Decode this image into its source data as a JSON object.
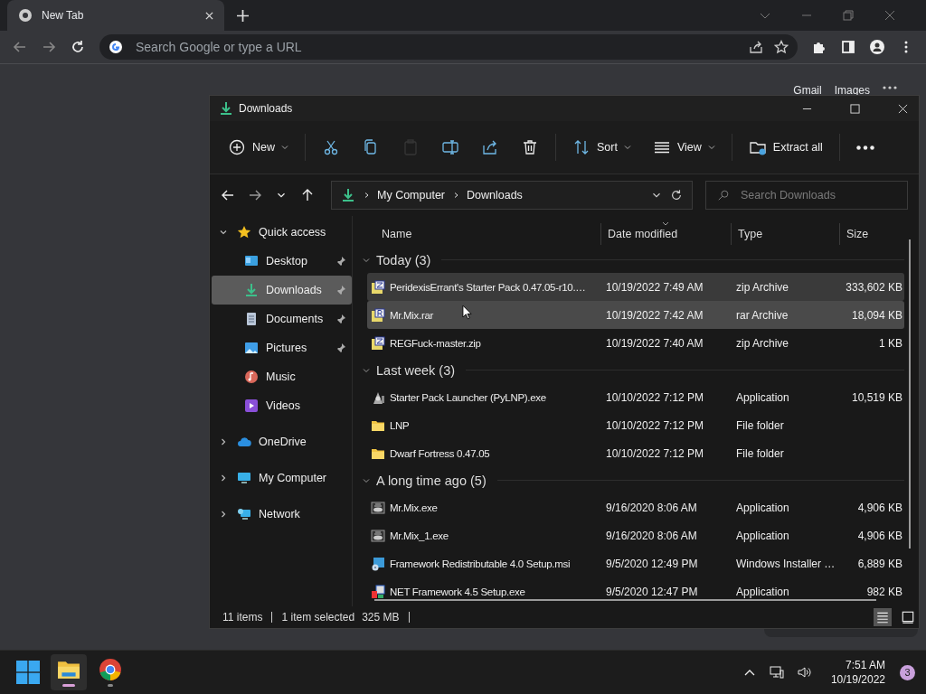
{
  "browser": {
    "tabs": [
      {
        "title": "New Tab",
        "selected": true
      }
    ],
    "address_bar": {
      "placeholder": "Search Google or type a URL"
    },
    "page_links": [
      "Gmail",
      "Images"
    ]
  },
  "explorer": {
    "window": {
      "title": "Downloads"
    },
    "command_bar": [
      {
        "kind": "new",
        "label": "New",
        "dropdown": true,
        "disabled": false
      },
      {
        "kind": "cut",
        "disabled": false
      },
      {
        "kind": "copy",
        "disabled": false
      },
      {
        "kind": "paste",
        "disabled": true
      },
      {
        "kind": "rename",
        "disabled": false
      },
      {
        "kind": "share",
        "disabled": false
      },
      {
        "kind": "delete",
        "disabled": false
      },
      {
        "kind": "sort",
        "label": "Sort",
        "dropdown": true,
        "disabled": false
      },
      {
        "kind": "view",
        "label": "View",
        "dropdown": true,
        "disabled": false
      },
      {
        "kind": "extract",
        "label": "Extract all",
        "dropdown": false,
        "disabled": false
      },
      {
        "kind": "more",
        "disabled": false
      }
    ],
    "breadcrumb": [
      "My Computer",
      "Downloads"
    ],
    "search": {
      "placeholder": "Search Downloads"
    },
    "navigation": [
      {
        "kind": "star",
        "label": "Quick access",
        "expanded": true,
        "selected": false,
        "children": [
          {
            "kind": "desktop",
            "label": "Desktop",
            "pinned": true,
            "selected": false
          },
          {
            "kind": "downloads",
            "label": "Downloads",
            "pinned": true,
            "selected": true
          },
          {
            "kind": "documents",
            "label": "Documents",
            "pinned": true,
            "selected": false
          },
          {
            "kind": "pictures",
            "label": "Pictures",
            "pinned": true,
            "selected": false
          },
          {
            "kind": "music",
            "label": "Music",
            "pinned": false,
            "selected": false
          },
          {
            "kind": "videos",
            "label": "Videos",
            "pinned": false,
            "selected": false
          }
        ]
      },
      {
        "kind": "cloud",
        "label": "OneDrive",
        "expanded": false,
        "selected": false
      },
      {
        "kind": "computer",
        "label": "My Computer",
        "expanded": false,
        "selected": false
      },
      {
        "kind": "network",
        "label": "Network",
        "expanded": false,
        "selected": false
      }
    ],
    "columns": [
      "Name",
      "Date modified",
      "Type",
      "Size"
    ],
    "groups": [
      {
        "title": "Today (3)",
        "expanded": true,
        "files": [
          {
            "kind": "zip",
            "name": "PeridexisErrant's Starter Pack 0.47.05-r10.…",
            "date": "10/19/2022 7:49 AM",
            "type": "zip Archive",
            "size": "333,602 KB",
            "selected": true,
            "hovered": false
          },
          {
            "kind": "rar",
            "name": "Mr.Mix.rar",
            "date": "10/19/2022 7:42 AM",
            "type": "rar Archive",
            "size": "18,094 KB",
            "selected": false,
            "hovered": true
          },
          {
            "kind": "zip",
            "name": "REGFuck-master.zip",
            "date": "10/19/2022 7:40 AM",
            "type": "zip Archive",
            "size": "1 KB",
            "selected": false,
            "hovered": false
          }
        ]
      },
      {
        "title": "Last week (3)",
        "expanded": true,
        "files": [
          {
            "kind": "launcher",
            "name": "Starter Pack Launcher (PyLNP).exe",
            "date": "10/10/2022 7:12 PM",
            "type": "Application",
            "size": "10,519 KB",
            "selected": false,
            "hovered": false
          },
          {
            "kind": "folder",
            "name": "LNP",
            "date": "10/10/2022 7:12 PM",
            "type": "File folder",
            "selected": false,
            "hovered": false
          },
          {
            "kind": "folder",
            "name": "Dwarf Fortress 0.47.05",
            "date": "10/10/2022 7:12 PM",
            "type": "File folder",
            "selected": false,
            "hovered": false
          }
        ]
      },
      {
        "title": "A long time ago (5)",
        "expanded": true,
        "files": [
          {
            "kind": "app",
            "name": "Mr.Mix.exe",
            "date": "9/16/2020 8:06 AM",
            "type": "Application",
            "size": "4,906 KB",
            "selected": false,
            "hovered": false
          },
          {
            "kind": "app",
            "name": "Mr.Mix_1.exe",
            "date": "9/16/2020 8:06 AM",
            "type": "Application",
            "size": "4,906 KB",
            "selected": false,
            "hovered": false
          },
          {
            "kind": "msi",
            "name": "Framework Redistributable 4.0 Setup.msi",
            "date": "9/5/2020 12:49 PM",
            "type": "Windows Installer …",
            "size": "6,889 KB",
            "selected": false,
            "hovered": false
          },
          {
            "kind": "setup",
            "name": "NET Framework 4.5 Setup.exe",
            "date": "9/5/2020 12:47 PM",
            "type": "Application",
            "size": "982 KB",
            "selected": false,
            "hovered": false
          }
        ]
      }
    ],
    "status_bar": {
      "item_count": "11 items",
      "selection": "1 item selected",
      "selection_size": "325 MB"
    },
    "view_modes": [
      {
        "kind": "details",
        "selected": true
      },
      {
        "kind": "tiles",
        "selected": false
      }
    ]
  },
  "taskbar": {
    "apps": [
      {
        "kind": "explorer",
        "active": true
      },
      {
        "kind": "chrome",
        "active": false
      }
    ],
    "clock": {
      "time": "7:51 AM",
      "date": "10/19/2022"
    },
    "notifications": "3"
  }
}
